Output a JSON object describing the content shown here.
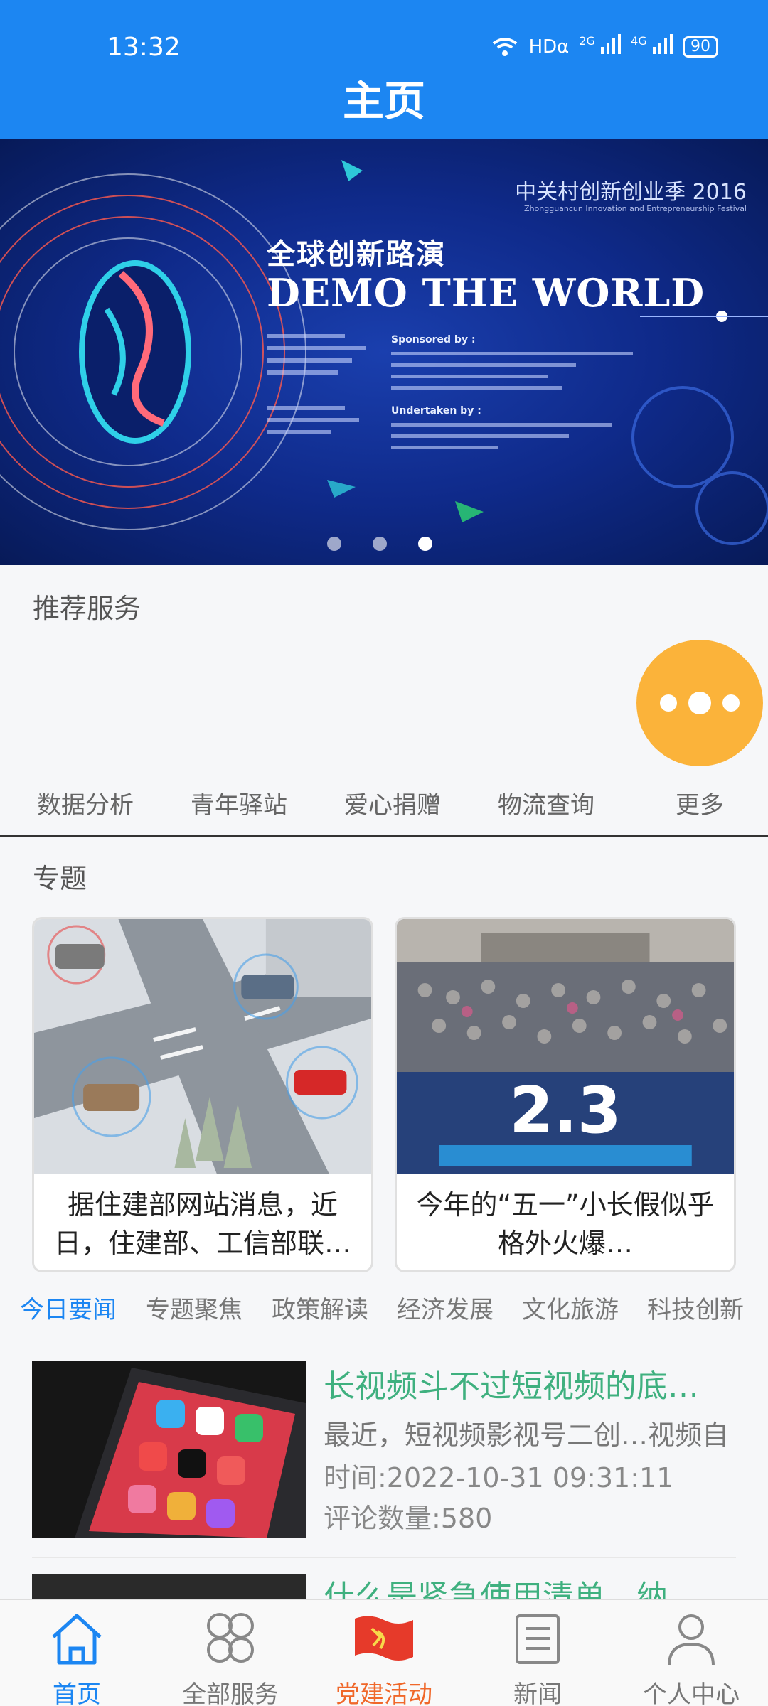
{
  "status": {
    "time": "13:32",
    "network": "HDα",
    "signal1": "2G",
    "signal2": "4G",
    "battery": "90"
  },
  "header": {
    "title": "主页"
  },
  "banner": {
    "headline": "全球创新路演",
    "main": "DEMO THE WORLD",
    "event": "中关村创新创业季 2016",
    "event_sub": "Zhongguancun Innovation and Entrepreneurship Festival",
    "sponsor_title": "Sponsored by :",
    "undertaken_title": "Undertaken by :",
    "slide_count": 3,
    "active_slide": 3
  },
  "recommended": {
    "title": "推荐服务",
    "items": [
      "数据分析",
      "青年驿站",
      "爱心捐赠",
      "物流查询",
      "更多"
    ]
  },
  "topics": {
    "title": "专题",
    "cards": [
      {
        "caption": "据住建部网站消息，近日，住建部、工信部联…",
        "image": "smart-traffic-illustration"
      },
      {
        "caption": "今年的“五一”小长假似乎格外火爆…",
        "image": "crowded-tourism-photo"
      }
    ]
  },
  "news_tabs": [
    "今日要闻",
    "专题聚焦",
    "政策解读",
    "经济发展",
    "文化旅游",
    "科技创新"
  ],
  "news": [
    {
      "title": "长视频斗不过短视频的底…",
      "summary": "最近，短视频影视号二创…视频自",
      "time": "时间:2022-10-31 09:31:11",
      "comments": "评论数量:580"
    },
    {
      "title": "什么是紧急使用清单，纳"
    }
  ],
  "bottom_nav": [
    {
      "label": "首页",
      "icon": "home-icon"
    },
    {
      "label": "全部服务",
      "icon": "grid-icon"
    },
    {
      "label": "党建活动",
      "icon": "party-flag-icon"
    },
    {
      "label": "新闻",
      "icon": "newspaper-icon"
    },
    {
      "label": "个人中心",
      "icon": "person-icon"
    }
  ],
  "colors": {
    "primary": "#1c86f2",
    "accent": "#fbb33a",
    "news_title": "#3fb07f",
    "party": "#f0682a"
  }
}
